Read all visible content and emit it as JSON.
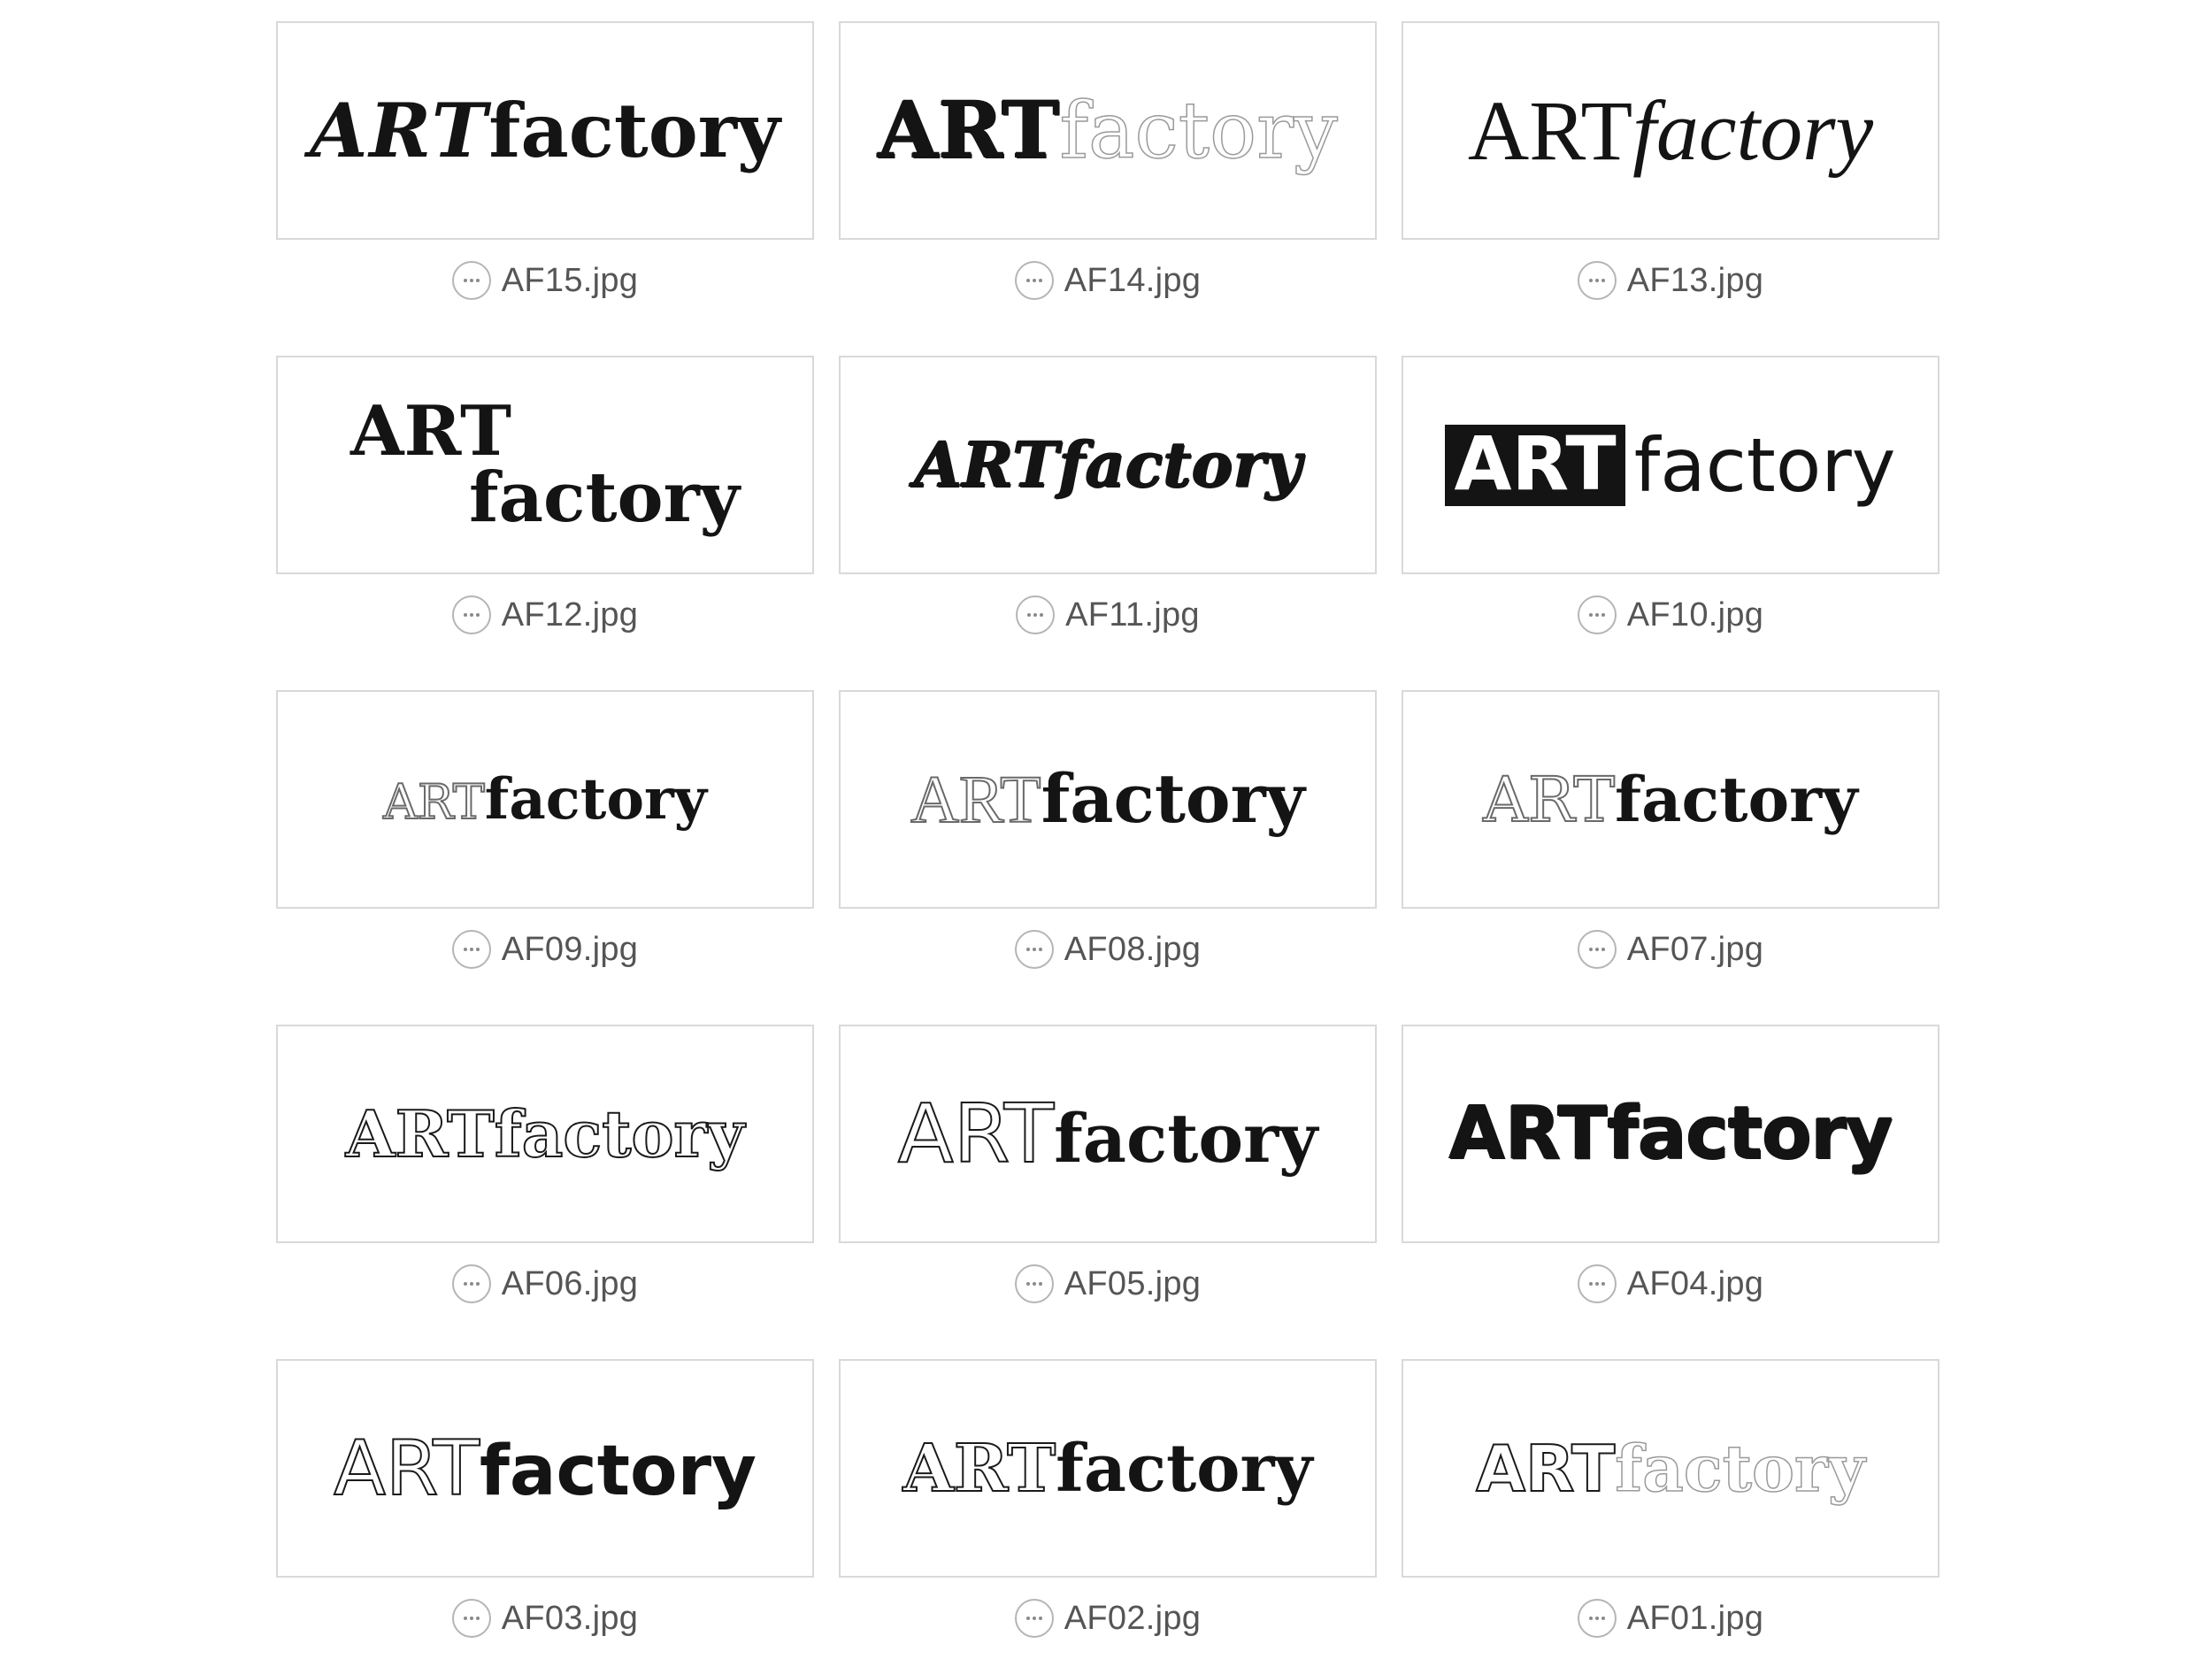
{
  "files": [
    {
      "filename": "AF15.jpg",
      "logo": {
        "art": "ART",
        "factory": "factory"
      }
    },
    {
      "filename": "AF14.jpg",
      "logo": {
        "art": "ART",
        "factory": "factory"
      }
    },
    {
      "filename": "AF13.jpg",
      "logo": {
        "art": "ART",
        "factory": "factory"
      }
    },
    {
      "filename": "AF12.jpg",
      "logo": {
        "art": "ART",
        "factory": "factory"
      }
    },
    {
      "filename": "AF11.jpg",
      "logo": {
        "art": "ART",
        "factory": "factory"
      }
    },
    {
      "filename": "AF10.jpg",
      "logo": {
        "art": "ART",
        "factory": "factory"
      }
    },
    {
      "filename": "AF09.jpg",
      "logo": {
        "art": "ART",
        "factory": "factory"
      }
    },
    {
      "filename": "AF08.jpg",
      "logo": {
        "art": "ART",
        "factory": "factory"
      }
    },
    {
      "filename": "AF07.jpg",
      "logo": {
        "art": "ART",
        "factory": "factory"
      }
    },
    {
      "filename": "AF06.jpg",
      "logo": {
        "art": "ART",
        "factory": "factory"
      }
    },
    {
      "filename": "AF05.jpg",
      "logo": {
        "art": "ART",
        "factory": "factory"
      }
    },
    {
      "filename": "AF04.jpg",
      "logo": {
        "art": "ART",
        "factory": "factory"
      }
    },
    {
      "filename": "AF03.jpg",
      "logo": {
        "art": "ART",
        "factory": "factory"
      }
    },
    {
      "filename": "AF02.jpg",
      "logo": {
        "art": "ART",
        "factory": "factory"
      }
    },
    {
      "filename": "AF01.jpg",
      "logo": {
        "art": "ART",
        "factory": "factory"
      }
    }
  ],
  "icons": {
    "caption": "more-options-icon"
  },
  "colors": {
    "thumb_border": "#d9d9d9",
    "ink": "#141414",
    "caption_text": "#555555",
    "icon_stroke": "#b5b5b5"
  }
}
